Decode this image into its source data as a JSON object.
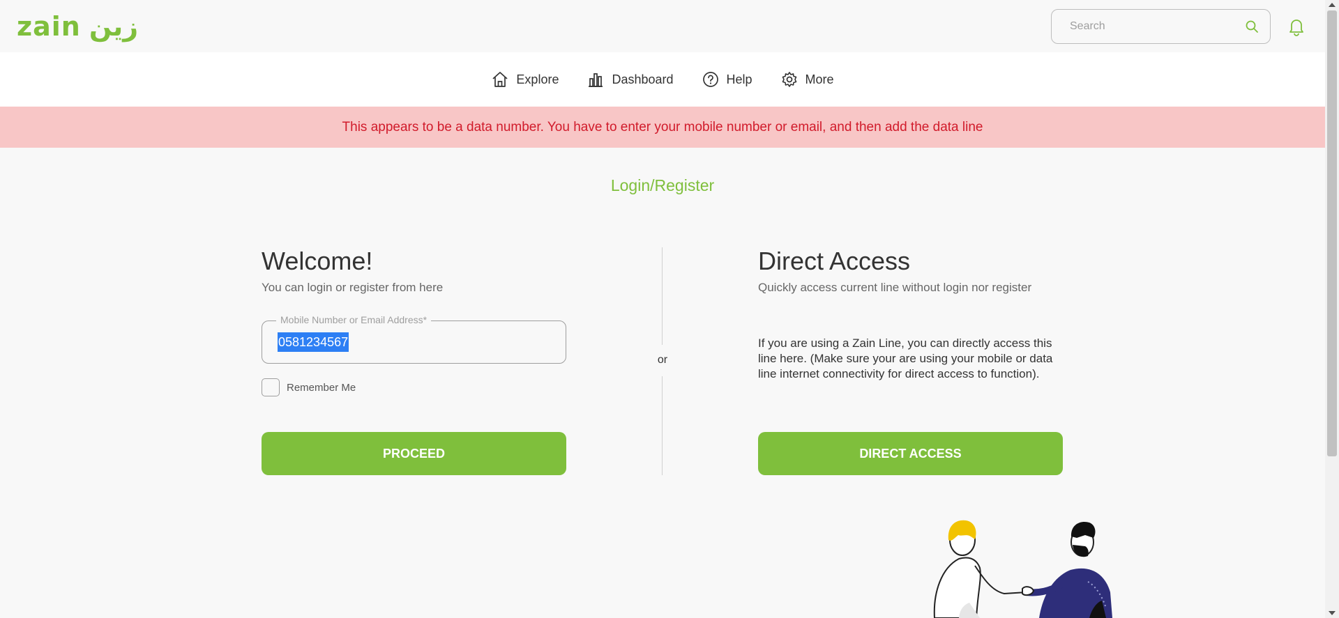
{
  "brand": {
    "logo_latin": "zain",
    "logo_arabic": "زين",
    "accent_color": "#7fbf3c",
    "error_color": "#d11b2b"
  },
  "header": {
    "search_placeholder": "Search",
    "search_icon": "search-icon",
    "notification_icon": "bell-icon"
  },
  "nav": {
    "items": [
      {
        "label": "Explore",
        "icon": "home-icon"
      },
      {
        "label": "Dashboard",
        "icon": "chart-icon"
      },
      {
        "label": "Help",
        "icon": "help-icon"
      },
      {
        "label": "More",
        "icon": "gear-icon"
      }
    ]
  },
  "alert": {
    "message": "This appears to be a data number. You have to enter your mobile number or email, and then add the data line"
  },
  "page": {
    "title": "Login/Register"
  },
  "login": {
    "heading": "Welcome!",
    "subheading": "You can login or register from here",
    "field_label": "Mobile Number or Email Address*",
    "field_value": "0581234567",
    "remember_label": "Remember Me",
    "remember_checked": false,
    "proceed_label": "PROCEED"
  },
  "separator": {
    "label": "or"
  },
  "direct": {
    "heading": "Direct Access",
    "subheading": "Quickly access current line without login nor register",
    "description": "If you are using a Zain Line, you can directly access this line here. (Make sure your are using your mobile or data line internet connectivity for direct access to function).",
    "button_label": "DIRECT ACCESS"
  }
}
